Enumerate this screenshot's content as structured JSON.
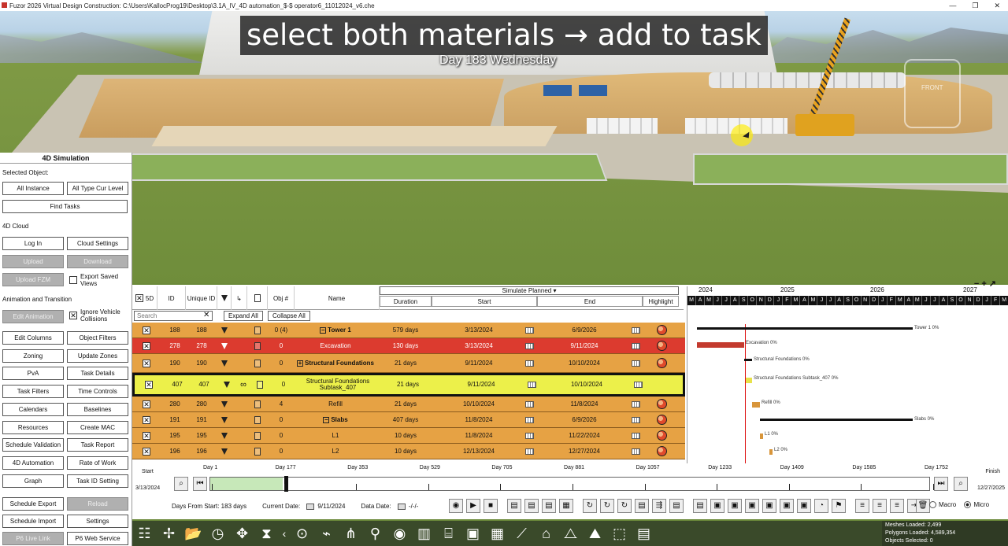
{
  "window": {
    "title": "Fuzor 2026 Virtual Design Construction: C:\\Users\\KallocProg19\\Desktop\\3.1A_IV_4D automation_$-$ operator6_11012024_v6.che",
    "buttons": [
      "—",
      "❐",
      "✕"
    ]
  },
  "scene": {
    "caption": "select both materials → add to task",
    "day_label": "Day 183 Wednesday",
    "nav_cube_label": "FRONT"
  },
  "left_panel": {
    "title": "4D Simulation",
    "selected_object_label": "Selected Object:",
    "all_instance": "All Instance",
    "all_type_cur_level": "All Type Cur Level",
    "find_tasks": "Find Tasks",
    "cloud_label": "4D Cloud",
    "log_in": "Log In",
    "cloud_settings": "Cloud Settings",
    "upload": "Upload",
    "download": "Download",
    "upload_fzm": "Upload FZM",
    "export_saved_views": "Export Saved Views",
    "anim_label": "Animation and Transition",
    "edit_animation": "Edit Animation",
    "ignore_vehicle": "Ignore Vehicle Collisions",
    "buttons": [
      [
        "Edit Columns",
        "Object Filters"
      ],
      [
        "Zoning",
        "Update Zones"
      ],
      [
        "PvA",
        "Task Details"
      ],
      [
        "Task Filters",
        "Time Controls"
      ],
      [
        "Calendars",
        "Baselines"
      ],
      [
        "Resources",
        "Create MAC"
      ],
      [
        "Schedule Validation",
        "Task Report"
      ],
      [
        "4D Automation",
        "Rate of Work"
      ],
      [
        "Graph",
        "Task ID Setting"
      ]
    ],
    "schedule_export": "Schedule Export",
    "reload": "Reload",
    "schedule_import": "Schedule Import",
    "settings": "Settings",
    "p6_live_link": "P6 Live Link",
    "p6_web_service": "P6 Web Service"
  },
  "grid": {
    "headers": {
      "fived": "5D",
      "id": "ID",
      "unique_id": "Unique ID",
      "obj": "Obj #",
      "name": "Name",
      "simulate": "Simulate Planned",
      "duration": "Duration",
      "start": "Start",
      "end": "End",
      "highlight": "Highlight"
    },
    "search_placeholder": "Search",
    "expand_all": "Expand All",
    "collapse_all": "Collapse All",
    "rows": [
      {
        "id": "188",
        "uid": "188",
        "obj": "0 (4)",
        "name": "Tower 1",
        "duration": "579 days",
        "start": "3/13/2024",
        "end": "6/9/2026"
      },
      {
        "id": "278",
        "uid": "278",
        "obj": "0",
        "name": "Excavation",
        "duration": "130 days",
        "start": "3/13/2024",
        "end": "9/11/2024"
      },
      {
        "id": "190",
        "uid": "190",
        "obj": "0",
        "name": "Structural Foundations",
        "duration": "21 days",
        "start": "9/11/2024",
        "end": "10/10/2024"
      },
      {
        "id": "407",
        "uid": "407",
        "obj": "0",
        "name": "Structural Foundations Subtask_407",
        "duration": "21 days",
        "start": "9/11/2024",
        "end": "10/10/2024"
      },
      {
        "id": "280",
        "uid": "280",
        "obj": "4",
        "name": "Refill",
        "duration": "21 days",
        "start": "10/10/2024",
        "end": "11/8/2024"
      },
      {
        "id": "191",
        "uid": "191",
        "obj": "0",
        "name": "Slabs",
        "duration": "407 days",
        "start": "11/8/2024",
        "end": "6/9/2026"
      },
      {
        "id": "195",
        "uid": "195",
        "obj": "0",
        "name": "L1",
        "duration": "10 days",
        "start": "11/8/2024",
        "end": "11/22/2024"
      },
      {
        "id": "196",
        "uid": "196",
        "obj": "0",
        "name": "L2",
        "duration": "10 days",
        "start": "12/13/2024",
        "end": "12/27/2024"
      }
    ]
  },
  "gantt": {
    "years": [
      "2024",
      "2025",
      "2026",
      "2027"
    ],
    "months": [
      "M",
      "A",
      "M",
      "J",
      "J",
      "A",
      "S",
      "O",
      "N",
      "D",
      "J",
      "F",
      "M",
      "A",
      "M",
      "J",
      "J",
      "A",
      "S",
      "O",
      "N",
      "D",
      "J",
      "F",
      "M",
      "A",
      "M",
      "J",
      "J",
      "A",
      "S",
      "O",
      "N",
      "D",
      "J",
      "F",
      "M"
    ],
    "labels": [
      "Tower 1   0%",
      "Excavation   0%",
      "Structural Foundations   0%",
      "Structural Foundations Subtask_407   0%",
      "Refill   0%",
      "Slabs   0%",
      "L1   0%",
      "L2   0%"
    ]
  },
  "timeline": {
    "start_label": "Start",
    "start_date": "3/13/2024",
    "finish_label": "Finish",
    "finish_date": "12/27/2025",
    "ticks": [
      "Day 1",
      "Day 177",
      "Day 353",
      "Day 529",
      "Day 705",
      "Day 881",
      "Day 1057",
      "Day 1233",
      "Day 1409",
      "Day 1585",
      "Day 1752"
    ],
    "days_from_start": "Days From Start: 183 days",
    "current_date_label": "Current Date:",
    "current_date": "9/11/2024",
    "data_date_label": "Data Date:",
    "data_date": "-/-/-",
    "macro": "Macro",
    "micro": "Micro"
  },
  "stats": {
    "meshes": "Meshes Loaded: 2,499",
    "polygons": "Polygons Loaded: 4,589,354",
    "selected": "Objects Selected: 0"
  }
}
